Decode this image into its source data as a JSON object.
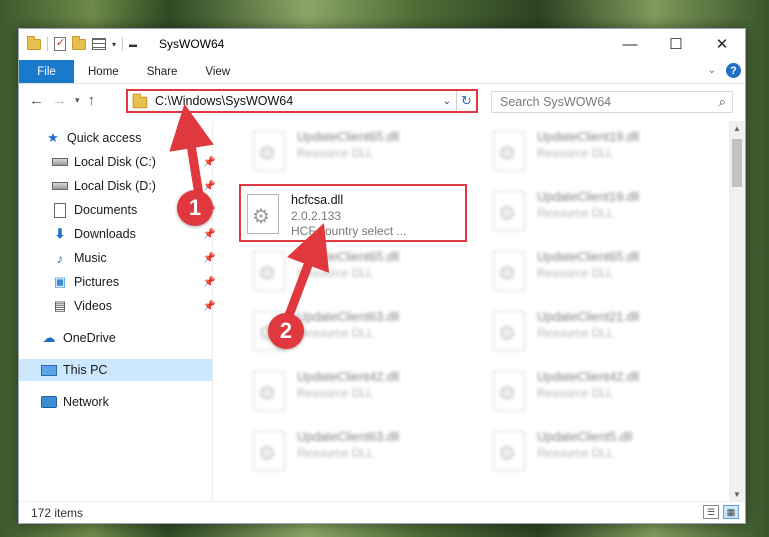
{
  "window": {
    "title": "SysWOW64",
    "controls": [
      "minimize-icon",
      "maximize-icon",
      "close-icon"
    ]
  },
  "ribbon": {
    "tabs": [
      "File",
      "Home",
      "Share",
      "View"
    ]
  },
  "address": {
    "path": "C:\\Windows\\SysWOW64",
    "search_placeholder": "Search SysWOW64"
  },
  "nav_pane": {
    "items": [
      {
        "label": "Quick access",
        "icon": "star-icon"
      },
      {
        "label": "Local Disk (C:)",
        "icon": "drive-icon",
        "pinned": true
      },
      {
        "label": "Local Disk (D:)",
        "icon": "drive-icon",
        "pinned": true
      },
      {
        "label": "Documents",
        "icon": "document-icon",
        "pinned": true
      },
      {
        "label": "Downloads",
        "icon": "download-icon",
        "pinned": true
      },
      {
        "label": "Music",
        "icon": "music-icon",
        "pinned": true
      },
      {
        "label": "Pictures",
        "icon": "pictures-icon",
        "pinned": true
      },
      {
        "label": "Videos",
        "icon": "videos-icon",
        "pinned": true
      },
      {
        "label": "OneDrive",
        "icon": "cloud-icon"
      },
      {
        "label": "This PC",
        "icon": "computer-icon",
        "selected": true
      },
      {
        "label": "Network",
        "icon": "network-icon"
      }
    ]
  },
  "files": {
    "highlighted": {
      "name": "hcfcsa.dll",
      "version": "2.0.2.133",
      "description": "HCF country select ..."
    },
    "left_column": [
      {
        "name": "UpdateClient65.dll",
        "type": "Resource DLL"
      },
      {
        "name": "UpdateClient65.dll",
        "type": "Resource DLL"
      },
      {
        "name": "UpdateClient63.dll",
        "type": "Resource DLL"
      },
      {
        "name": "UpdateClient42.dll",
        "type": "Resource DLL"
      },
      {
        "name": "UpdateClient63.dll",
        "type": "Resource DLL"
      }
    ],
    "right_column": [
      {
        "name": "UpdateClient19.dll",
        "type": "Resource DLL"
      },
      {
        "name": "UpdateClient19.dll",
        "type": "Resource DLL"
      },
      {
        "name": "UpdateClient65.dll",
        "type": "Resource DLL"
      },
      {
        "name": "UpdateClient21.dll",
        "type": "Resource DLL"
      },
      {
        "name": "UpdateClient42.dll",
        "type": "Resource DLL"
      },
      {
        "name": "UpdateClient5.dll",
        "type": "Resource DLL"
      }
    ]
  },
  "status": {
    "item_count": "172 items"
  },
  "annotations": {
    "marker_1": "1",
    "marker_2": "2",
    "color": "#e0383e"
  }
}
